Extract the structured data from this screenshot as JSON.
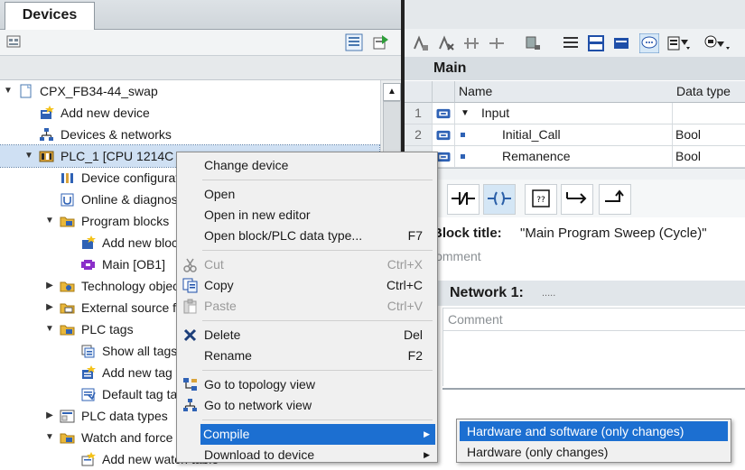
{
  "devices_panel": {
    "tab_title": "Devices",
    "tree": [
      {
        "label": "CPX_FB34-44_swap",
        "icon": "project-icon",
        "expand": "open"
      },
      {
        "label": "Add new device",
        "icon": "add-device-icon",
        "expand": "none"
      },
      {
        "label": "Devices & networks",
        "icon": "network-icon",
        "expand": "none"
      },
      {
        "label": "PLC_1 [CPU 1214C DC/DC/DC]",
        "icon": "plc-icon",
        "expand": "open",
        "selected": true
      },
      {
        "label": "Device configuration",
        "icon": "device-config-icon",
        "expand": "none"
      },
      {
        "label": "Online & diagnostics",
        "icon": "online-diagnostics-icon",
        "expand": "none"
      },
      {
        "label": "Program blocks",
        "icon": "folder-icon",
        "expand": "open"
      },
      {
        "label": "Add new block",
        "icon": "add-block-icon",
        "expand": "none"
      },
      {
        "label": "Main [OB1]",
        "icon": "ob-block-icon",
        "expand": "none"
      },
      {
        "label": "Technology objects",
        "icon": "technology-objects-icon",
        "expand": "closed"
      },
      {
        "label": "External source files",
        "icon": "external-source-icon",
        "expand": "closed"
      },
      {
        "label": "PLC tags",
        "icon": "folder-icon",
        "expand": "open"
      },
      {
        "label": "Show all tags",
        "icon": "show-tags-icon",
        "expand": "none"
      },
      {
        "label": "Add new tag table",
        "icon": "add-tag-table-icon",
        "expand": "none"
      },
      {
        "label": "Default tag table",
        "icon": "tag-table-icon",
        "expand": "none"
      },
      {
        "label": "PLC data types",
        "icon": "data-types-icon",
        "expand": "closed"
      },
      {
        "label": "Watch and force tables",
        "icon": "folder-icon",
        "expand": "open"
      },
      {
        "label": "Add new watch table",
        "icon": "add-watch-table-icon",
        "expand": "none"
      }
    ]
  },
  "editor": {
    "main_title": "Main",
    "interface": {
      "col_name": "Name",
      "col_type": "Data type",
      "rows": [
        {
          "num": "1",
          "name": "Input",
          "type": "",
          "level": 0,
          "expanded": true
        },
        {
          "num": "2",
          "name": "Initial_Call",
          "type": "Bool",
          "level": 1
        },
        {
          "num": "3",
          "name": "Remanence",
          "type": "Bool",
          "level": 1
        }
      ]
    },
    "lad_buttons": [
      "-|/|-",
      "-()-",
      "??",
      "|->",
      "-^"
    ],
    "block_title_label": "Block title:",
    "block_title_value": "\"Main Program Sweep (Cycle)\"",
    "comment_placeholder": "Comment",
    "network_label": "Network 1:",
    "network_dots": ".....",
    "network_comment": "Comment"
  },
  "context_menu": {
    "items": [
      {
        "label": "Change device",
        "shortcut": "",
        "icon": ""
      },
      {
        "sep": true
      },
      {
        "label": "Open",
        "shortcut": "",
        "icon": ""
      },
      {
        "label": "Open in new editor",
        "shortcut": "",
        "icon": ""
      },
      {
        "label": "Open block/PLC data type...",
        "shortcut": "F7",
        "icon": ""
      },
      {
        "sep": true
      },
      {
        "label": "Cut",
        "shortcut": "Ctrl+X",
        "icon": "cut-icon",
        "disabled": true
      },
      {
        "label": "Copy",
        "shortcut": "Ctrl+C",
        "icon": "copy-icon"
      },
      {
        "label": "Paste",
        "shortcut": "Ctrl+V",
        "icon": "paste-icon",
        "disabled": true
      },
      {
        "sep": true
      },
      {
        "label": "Delete",
        "shortcut": "Del",
        "icon": "delete-icon"
      },
      {
        "label": "Rename",
        "shortcut": "F2",
        "icon": ""
      },
      {
        "sep": true
      },
      {
        "label": "Go to topology view",
        "shortcut": "",
        "icon": "topology-icon"
      },
      {
        "label": "Go to network view",
        "shortcut": "",
        "icon": "network-view-icon"
      },
      {
        "sep": true
      },
      {
        "label": "Compile",
        "shortcut": "",
        "icon": "",
        "submenu": true,
        "highlighted": true
      },
      {
        "label": "Download to device",
        "shortcut": "",
        "icon": "",
        "submenu": true
      }
    ]
  },
  "compile_submenu": {
    "items": [
      {
        "label": "Hardware and software (only changes)",
        "highlighted": true
      },
      {
        "label": "Hardware (only changes)"
      }
    ]
  },
  "colors": {
    "selection": "#1c6fd1",
    "tree_selection": "#cfe0f3",
    "folder": "#e9b73a",
    "block_purple": "#8b2fc9"
  }
}
